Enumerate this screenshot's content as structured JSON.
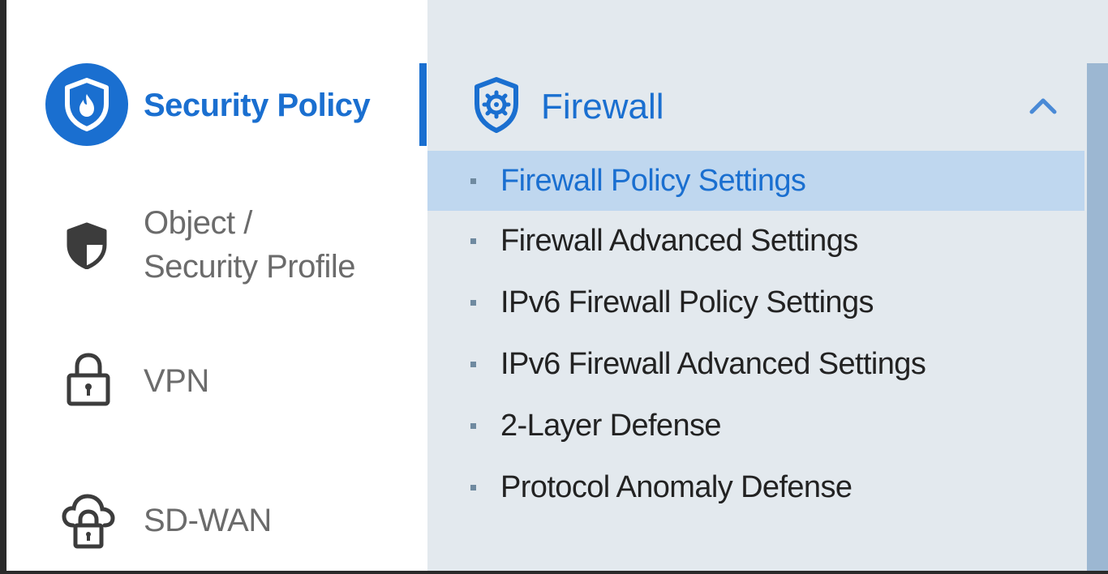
{
  "left_menu": {
    "items": [
      {
        "label": "Security Policy",
        "icon": "shield-flame-icon",
        "active": true
      },
      {
        "label": "Object /\nSecurity Profile",
        "icon": "shield-half-icon",
        "active": false
      },
      {
        "label": "VPN",
        "icon": "lock-icon",
        "active": false
      },
      {
        "label": "SD-WAN",
        "icon": "cloud-lock-icon",
        "active": false
      }
    ]
  },
  "submenu": {
    "group": {
      "label": "Firewall",
      "icon": "shield-gear-icon",
      "expanded_icon": "chevron-up-icon"
    },
    "items": [
      {
        "label": "Firewall Policy Settings",
        "selected": true
      },
      {
        "label": "Firewall Advanced Settings",
        "selected": false
      },
      {
        "label": "IPv6 Firewall Policy Settings",
        "selected": false
      },
      {
        "label": "IPv6 Firewall Advanced Settings",
        "selected": false
      },
      {
        "label": "2-Layer Defense",
        "selected": false
      },
      {
        "label": "Protocol Anomaly Defense",
        "selected": false
      }
    ]
  },
  "colors": {
    "accent": "#1a6fd0",
    "panel_bg": "#e3e9ee",
    "selected_bg": "#bfd7ef",
    "scrollbar": "#9cb7d2",
    "inactive_text": "#6b6b6b"
  }
}
